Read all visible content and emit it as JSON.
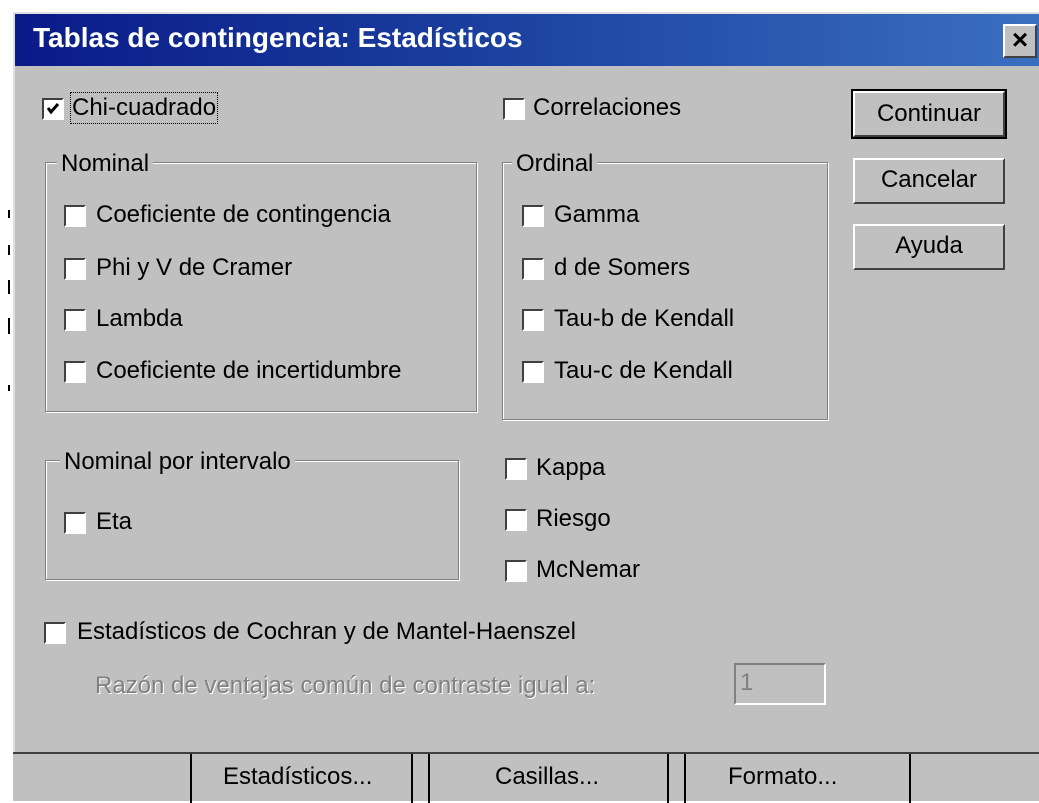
{
  "window": {
    "title": "Tablas de contingencia: Estadísticos",
    "close_glyph": "×"
  },
  "top_checks": {
    "chi_cuadrado": {
      "label": "Chi-cuadrado",
      "checked": true
    },
    "correlaciones": {
      "label": "Correlaciones",
      "checked": false
    }
  },
  "nominal": {
    "legend": "Nominal",
    "items": [
      {
        "label": "Coeficiente de contingencia",
        "checked": false
      },
      {
        "label": "Phi y V de Cramer",
        "checked": false
      },
      {
        "label": "Lambda",
        "checked": false
      },
      {
        "label": "Coeficiente de incertidumbre",
        "checked": false
      }
    ]
  },
  "ordinal": {
    "legend": "Ordinal",
    "items": [
      {
        "label": "Gamma",
        "checked": false
      },
      {
        "label": "d de Somers",
        "checked": false
      },
      {
        "label": "Tau-b de Kendall",
        "checked": false
      },
      {
        "label": "Tau-c de Kendall",
        "checked": false
      }
    ]
  },
  "nominal_intervalo": {
    "legend": "Nominal por intervalo",
    "items": [
      {
        "label": "Eta",
        "checked": false
      }
    ]
  },
  "other_checks": [
    {
      "label": "Kappa",
      "checked": false
    },
    {
      "label": "Riesgo",
      "checked": false
    },
    {
      "label": "McNemar",
      "checked": false
    }
  ],
  "cochran": {
    "label": "Estadísticos de Cochran y de Mantel-Haenszel",
    "checked": false,
    "ratio_label": "Razón de ventajas común de contraste igual a:",
    "ratio_value": "1"
  },
  "buttons": {
    "continuar": "Continuar",
    "cancelar": "Cancelar",
    "ayuda": "Ayuda"
  },
  "bottom_tabs": {
    "estadisticos": "Estadísticos...",
    "casillas": "Casillas...",
    "formato": "Formato..."
  },
  "colors": {
    "face": "#c0c0c0",
    "title_start": "#0a1a88",
    "title_end": "#3a6fc0",
    "disabled_text": "#808080"
  }
}
